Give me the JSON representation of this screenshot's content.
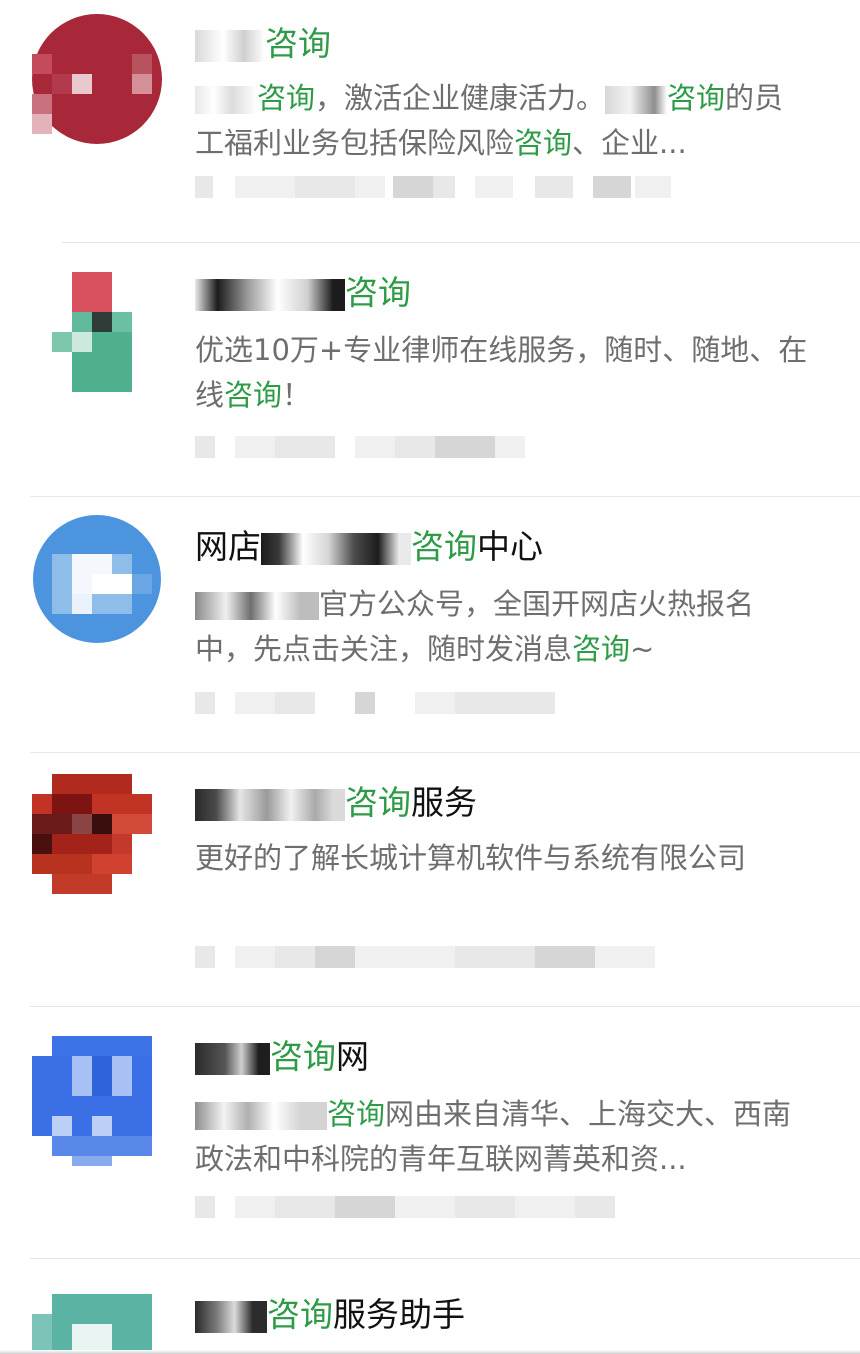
{
  "results": [
    {
      "title_pre": "",
      "title_keyword": "咨询",
      "title_post": "",
      "desc_pre": "",
      "desc_keyword": "咨询",
      "desc_mid": "，激活企业健康活力。",
      "desc_keyword2": "咨询",
      "desc_line2": "的员工福利业务包括保险风险",
      "desc_keyword3": "咨询",
      "desc_tail": "、企业..."
    },
    {
      "title_pre": "",
      "title_keyword": "咨询",
      "title_post": "",
      "desc_text": "优选10万+专业律师在线服务，随时、随地、在线",
      "desc_keyword": "咨询",
      "desc_tail": "！"
    },
    {
      "title_pre": "网店",
      "title_keyword": "咨询",
      "title_post": "中心",
      "desc_pre": "官方公众号，全国开网店火热报名中，先点击关注，随时发消息",
      "desc_keyword": "咨询",
      "desc_tail": "~"
    },
    {
      "title_pre": "",
      "title_keyword": "咨询",
      "title_post": "服务",
      "desc_text": "更好的了解长城计算机软件与系统有限公司"
    },
    {
      "title_pre": "",
      "title_keyword": "咨询",
      "title_post": "网",
      "desc_keyword": "咨询",
      "desc_mid": "网由来自清华、上海交大、",
      "desc_line2": "西南政法和中科院的青年互联网菁英和资..."
    },
    {
      "title_pre": "",
      "title_keyword": "咨询",
      "title_post": "服务助手"
    }
  ],
  "colors": {
    "keyword": "#2e9b47",
    "title": "#111111",
    "description": "#6e6e6e",
    "divider": "#e6e6e6"
  }
}
